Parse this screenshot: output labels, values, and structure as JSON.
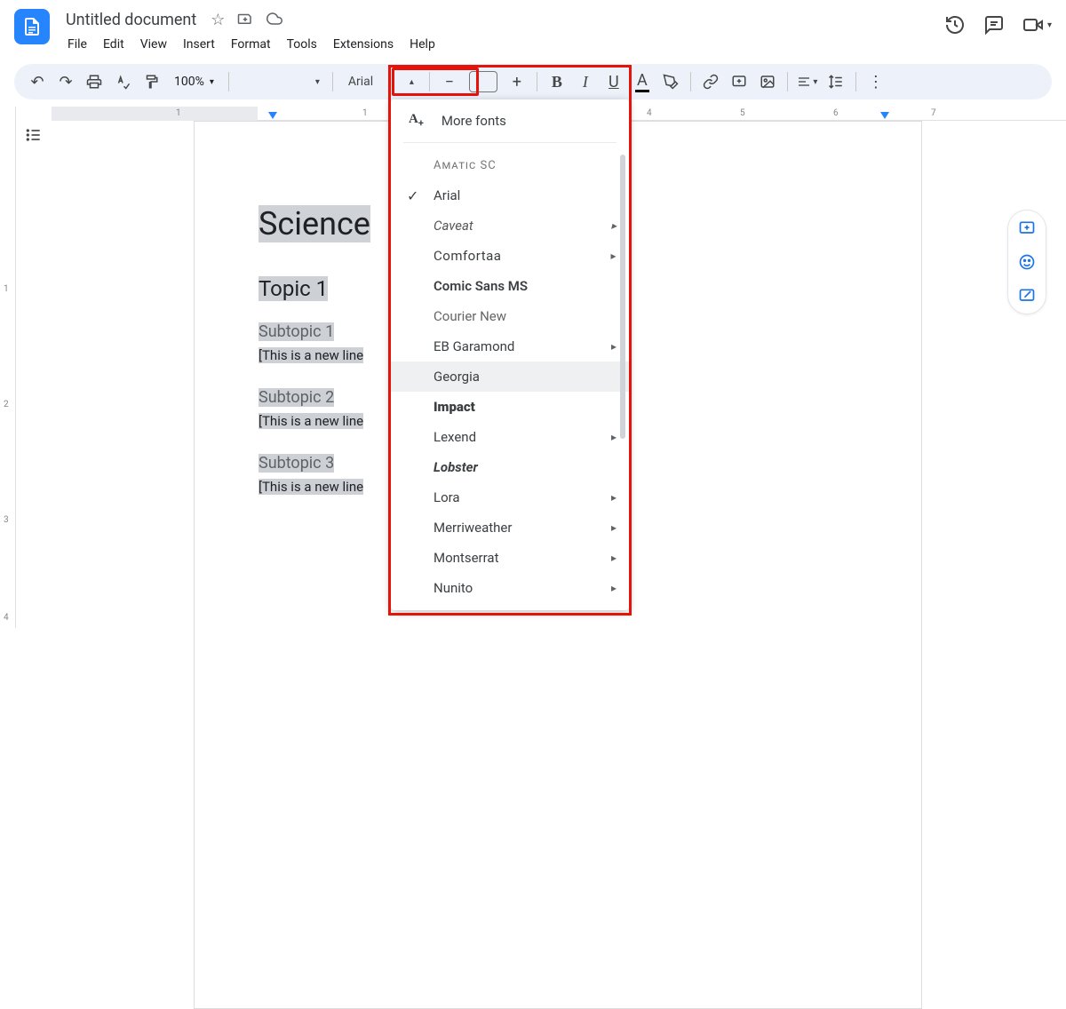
{
  "doc": {
    "title": "Untitled document"
  },
  "menubar": [
    "File",
    "Edit",
    "View",
    "Insert",
    "Format",
    "Tools",
    "Extensions",
    "Help"
  ],
  "toolbar": {
    "zoom": "100%",
    "font": "Arial"
  },
  "hruler": {
    "ticks": [
      "1",
      "1",
      "4",
      "5",
      "6",
      "7"
    ],
    "positions": [
      40,
      250,
      570,
      680,
      785,
      890
    ]
  },
  "vruler": {
    "ticks": [
      "1",
      "2",
      "3",
      "4"
    ],
    "positions": [
      200,
      330,
      460,
      570
    ]
  },
  "document": {
    "title": "Science",
    "sections": [
      {
        "topic": "Topic 1",
        "subtopic": "Subtopic 1",
        "line": "[This is a new line"
      },
      {
        "topic": "",
        "subtopic": "Subtopic 2",
        "line": "[This is a new line"
      },
      {
        "topic": "",
        "subtopic": "Subtopic 3",
        "line": "[This is a new line"
      }
    ]
  },
  "fontmenu": {
    "more": "More fonts",
    "selected": "Arial",
    "hovered": "Georgia",
    "items": [
      {
        "label": "Amatic SC",
        "family": "cursive",
        "style": "font-variant:small-caps;letter-spacing:1px;color:#777;font-size:13px"
      },
      {
        "label": "Arial",
        "family": "Arial,sans-serif",
        "checked": true
      },
      {
        "label": "Caveat",
        "family": "cursive",
        "style": "font-style:italic;color:#555",
        "submenu": true
      },
      {
        "label": "Comfortaa",
        "family": "sans-serif",
        "style": "letter-spacing:0.5px",
        "submenu": true
      },
      {
        "label": "Comic Sans MS",
        "family": "'Comic Sans MS',cursive",
        "style": "font-weight:600"
      },
      {
        "label": "Courier New",
        "family": "'Courier New',monospace",
        "style": "color:#666"
      },
      {
        "label": "EB Garamond",
        "family": "Garamond,serif",
        "submenu": true
      },
      {
        "label": "Georgia",
        "family": "Georgia,serif",
        "hover": true
      },
      {
        "label": "Impact",
        "family": "Impact,sans-serif",
        "style": "font-weight:900"
      },
      {
        "label": "Lexend",
        "family": "sans-serif",
        "submenu": true
      },
      {
        "label": "Lobster",
        "family": "cursive",
        "style": "font-weight:700;font-style:italic"
      },
      {
        "label": "Lora",
        "family": "serif",
        "submenu": true
      },
      {
        "label": "Merriweather",
        "family": "Georgia,serif",
        "submenu": true
      },
      {
        "label": "Montserrat",
        "family": "sans-serif",
        "submenu": true
      },
      {
        "label": "Nunito",
        "family": "sans-serif",
        "submenu": true
      }
    ]
  }
}
